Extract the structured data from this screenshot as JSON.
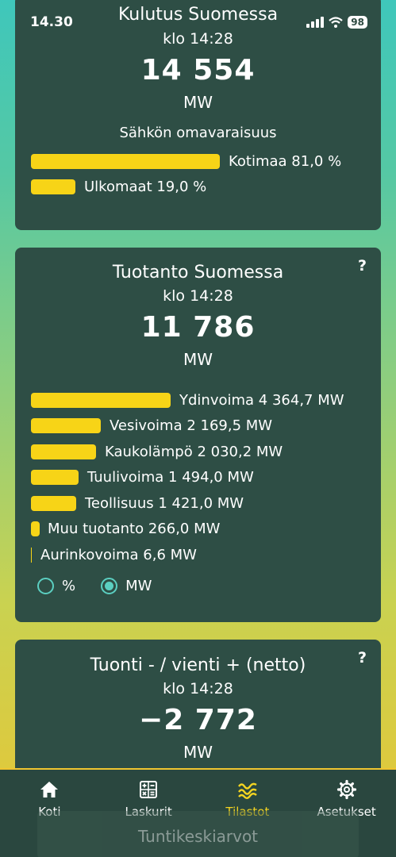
{
  "status": {
    "time": "14.30",
    "battery": "98"
  },
  "consumption": {
    "title": "Kulutus Suomessa",
    "time": "klo 14:28",
    "value": "14 554",
    "unit": "MW",
    "self_sufficiency_title": "Sähkön omavaraisuus",
    "bars": [
      {
        "label": "Kotimaa 81,0 %",
        "value": 81.0
      },
      {
        "label": "Ulkomaat 19,0 %",
        "value": 19.0
      }
    ]
  },
  "production": {
    "title": "Tuotanto Suomessa",
    "help": "?",
    "time": "klo 14:28",
    "value": "11 786",
    "unit": "MW",
    "bars": [
      {
        "label": "Ydinvoima 4 364,7 MW",
        "value": 4364.7
      },
      {
        "label": "Vesivoima 2 169,5 MW",
        "value": 2169.5
      },
      {
        "label": "Kaukolämpö 2 030,2 MW",
        "value": 2030.2
      },
      {
        "label": "Tuulivoima 1 494,0 MW",
        "value": 1494.0
      },
      {
        "label": "Teollisuus 1 421,0 MW",
        "value": 1421.0
      },
      {
        "label": "Muu tuotanto 266,0 MW",
        "value": 266.0
      },
      {
        "label": "Aurinkovoima 6,6 MW",
        "value": 6.6
      }
    ],
    "unit_options": [
      {
        "label": "%",
        "selected": false
      },
      {
        "label": "MW",
        "selected": true
      }
    ]
  },
  "net_import": {
    "title": "Tuonti - / vienti + (netto)",
    "help": "?",
    "time": "klo 14:28",
    "value": "−2 772",
    "unit": "MW"
  },
  "next_card_title": "Tuntikeskiarvot",
  "tabs": [
    {
      "label": "Koti",
      "icon": "home-icon",
      "active": false
    },
    {
      "label": "Laskurit",
      "icon": "calculator-icon",
      "active": false
    },
    {
      "label": "Tilastot",
      "icon": "stats-icon",
      "active": true
    },
    {
      "label": "Asetukset",
      "icon": "gear-icon",
      "active": false
    }
  ],
  "colors": {
    "card": "#2e4e45",
    "bar": "#f7d417",
    "accent": "#5bcfc1",
    "active_tab": "#f2d321"
  }
}
